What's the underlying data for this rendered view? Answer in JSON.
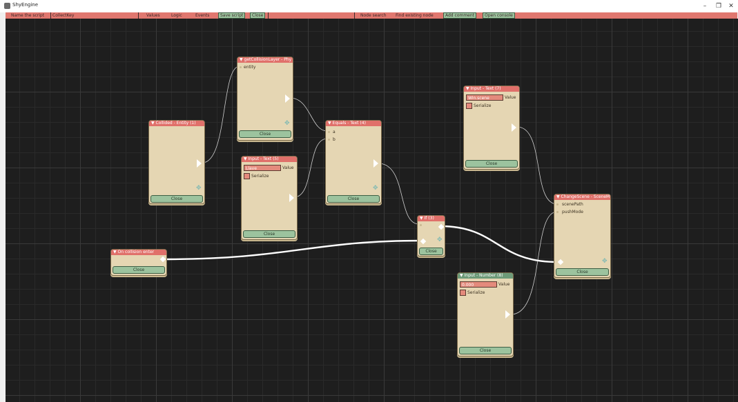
{
  "window": {
    "title": "ShyEngine",
    "minimize": "–",
    "maximize": "❐",
    "close": "✕"
  },
  "toolbar": {
    "name_label": "Name the script",
    "script_name": "CollectKey",
    "values": "Values",
    "logic": "Logic",
    "events": "Events",
    "save_script": "Save script",
    "close": "Close",
    "node_search": "Node search",
    "find_existing_node": "Find existing node",
    "add_comment": "Add comment",
    "open_console": "Open console"
  },
  "nodes": {
    "collided": {
      "title": "▼ Collided - Entity (1)",
      "close": "Close"
    },
    "get_collision_layer": {
      "title": "▼ getCollisionLayer - Phy",
      "port_entity": "entity",
      "close": "Close"
    },
    "input_text_5": {
      "title": "▼ Input - Text (5)",
      "value": "Llave",
      "value_label": "Value",
      "serialize": "Serialize",
      "close": "Close"
    },
    "equals_text_4": {
      "title": "▼ Equals - Text (4)",
      "port_a": "a",
      "port_b": "b",
      "close": "Close"
    },
    "input_text_7": {
      "title": "▼ Input - Text (7)",
      "value": "Win.scene",
      "value_label": "Value",
      "serialize": "Serialize",
      "close": "Close"
    },
    "if_3": {
      "title": "▼ If (3)",
      "close": "Close"
    },
    "on_collision_enter": {
      "title": "▼ On collision enter",
      "close": "Close"
    },
    "change_scene": {
      "title": "▼ ChangeScene - SceneM",
      "port_scene_path": "scenePath",
      "port_push_mode": "pushMode",
      "close": "Close"
    },
    "input_number_8": {
      "title": "▼ Input - Number (8)",
      "value": "0.000",
      "value_label": "Value",
      "serialize": "Serialize",
      "close": "Close"
    }
  },
  "icons": {
    "move": "✥"
  },
  "colors": {
    "canvas_bg": "#1e1e1e",
    "node_bg": "#e5d6b3",
    "node_header": "#e0706a",
    "node_header_alt": "#6d9a78",
    "button_green": "#9cc39e",
    "toolbar_red": "#e0776f"
  }
}
